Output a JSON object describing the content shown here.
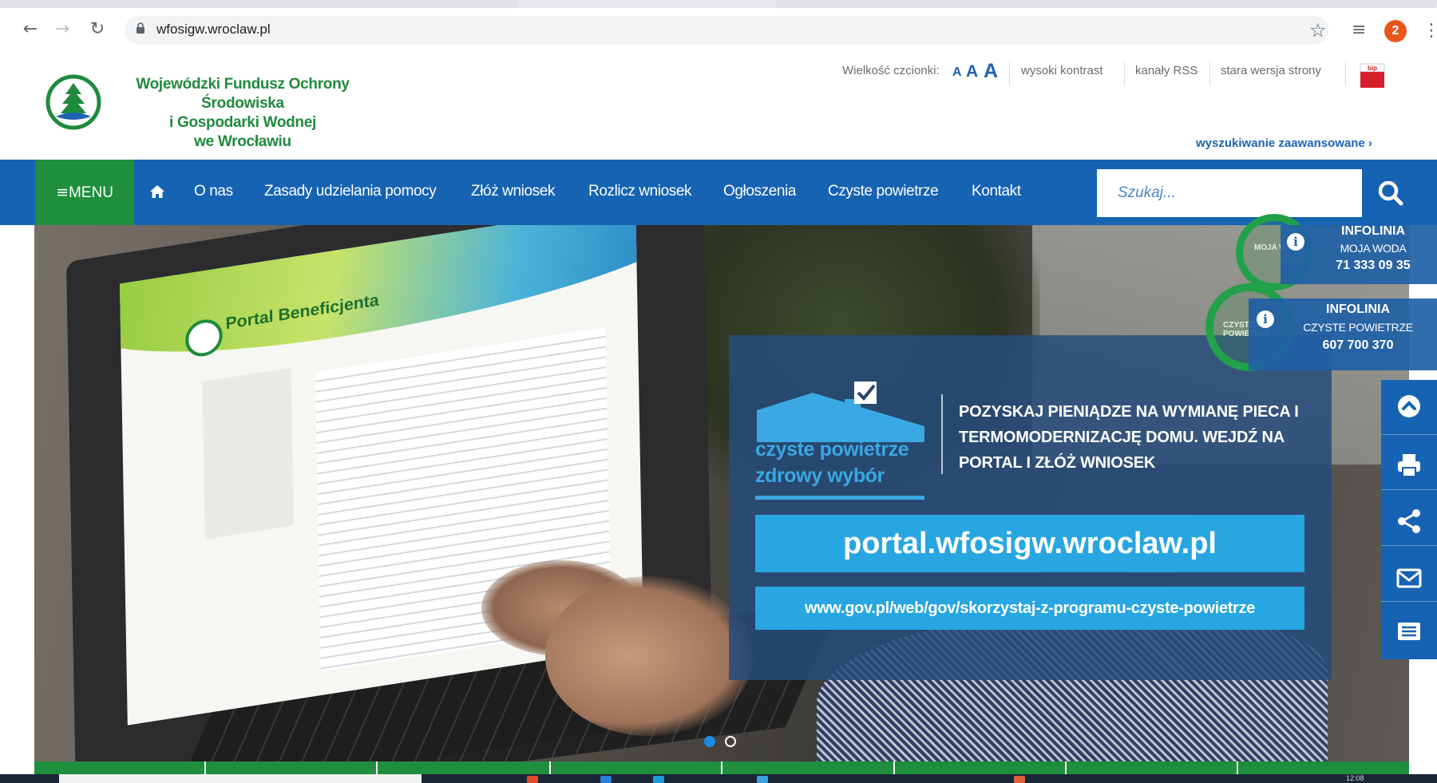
{
  "browser": {
    "url": "wfosigw.wroclaw.pl",
    "profile_badge": "2",
    "icons": [
      "back-icon",
      "forward-icon",
      "reload-icon",
      "lock-icon",
      "star-icon",
      "extension-icon",
      "menu-kebab-icon"
    ]
  },
  "header": {
    "logo_line1": "Wojewódzki Fundusz Ochrony Środowiska",
    "logo_line2": "i Gospodarki Wodnej",
    "logo_line3": "we Wrocławiu",
    "font_size_label": "Wielkość czcionki:",
    "font_size_options": [
      "A",
      "A",
      "A"
    ],
    "high_contrast": "wysoki kontrast",
    "rss": "kanały RSS",
    "old_version": "stara wersja strony",
    "bip_label": "bip",
    "advanced_search": "wyszukiwanie zaawansowane"
  },
  "nav": {
    "menu_label": "MENU",
    "items": [
      "O nas",
      "Zasady udzielania pomocy",
      "Złóż wniosek",
      "Rozlicz wniosek",
      "Ogłoszenia",
      "Czyste powietrze",
      "Kontakt"
    ],
    "search_placeholder": "Szukaj..."
  },
  "hero": {
    "screen_title": "Portal Beneficjenta",
    "program_line1": "czyste powietrze",
    "program_line2": "zdrowy wybór",
    "headline": "POZYSKAJ PIENIĄDZE NA WYMIANĘ PIECA I TERMOMODERNIZACJĘ DOMU. WEJDŹ NA PORTAL I ZŁÓŻ WNIOSEK",
    "portal_url": "portal.wfosigw.wroclaw.pl",
    "gov_url": "www.gov.pl/web/gov/skorzystaj-z-programu-czyste-powietrze",
    "active_slide": 1,
    "slides_total": 2
  },
  "infolinia": [
    {
      "badge": "MOJA WODA",
      "title": "INFOLINIA",
      "subtitle": "MOJA WODA",
      "phone": "71 333 09 35"
    },
    {
      "badge": "CZYSTE POWIETRZE",
      "title": "INFOLINIA",
      "subtitle": "CZYSTE POWIETRZE",
      "phone": "607 700 370"
    }
  ],
  "side_tools": [
    "scroll-top-icon",
    "print-icon",
    "share-icon",
    "mail-icon",
    "list-icon"
  ],
  "taskbar": {
    "time": "12:08"
  },
  "colors": {
    "brand_blue": "#1663b3",
    "brand_green": "#1f8e3d",
    "accent_cyan": "#27a6e1",
    "profile_orange": "#e8561c"
  }
}
